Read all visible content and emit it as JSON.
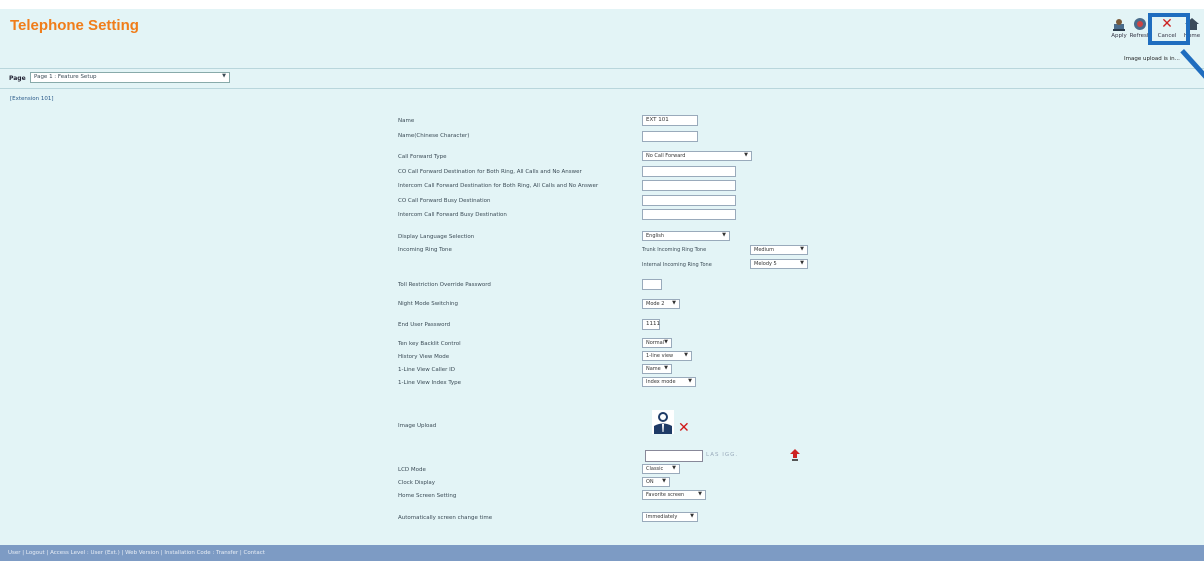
{
  "header": {
    "title": "Telephone Setting",
    "toolbar": {
      "apply_label": "Apply",
      "refresh_label": "Refresh",
      "cancel_label": "Cancel",
      "home_label": "Home"
    },
    "upload_message": "Image upload is in..."
  },
  "page": {
    "label": "Page",
    "selected": "Page 1 : Feature Setup"
  },
  "extension_label": "[Extension 101]",
  "form": {
    "name": {
      "label": "Name",
      "value": "EXT 101"
    },
    "name_chinese": {
      "label": "Name(Chinese Character)",
      "value": ""
    },
    "call_forward_type": {
      "label": "Call Forward Type",
      "value": "No Call Forward"
    },
    "co_cf_dest_all": {
      "label": "CO Call Forward Destination for Both Ring, All Calls and No Answer",
      "value": ""
    },
    "icm_cf_dest_all": {
      "label": "Intercom Call Forward Destination for Both Ring, All Calls and No Answer",
      "value": ""
    },
    "co_cf_busy": {
      "label": "CO Call Forward Busy Destination",
      "value": ""
    },
    "icm_cf_busy": {
      "label": "Intercom Call Forward Busy Destination",
      "value": ""
    },
    "display_language": {
      "label": "Display Language Selection",
      "value": "English"
    },
    "incoming_ring_tone": {
      "label": "Incoming Ring Tone",
      "trunk_label": "Trunk Incoming Ring Tone",
      "trunk_value": "Medium",
      "internal_label": "Internal Incoming Ring Tone",
      "internal_value": "Melody 5"
    },
    "toll_override": {
      "label": "Toll Restriction Override Password",
      "value": ""
    },
    "night_mode": {
      "label": "Night Mode Switching",
      "value": "Mode 2"
    },
    "end_user_password": {
      "label": "End User Password",
      "value": "1111"
    },
    "tenkey_backlit": {
      "label": "Ten key Backlit Control",
      "value": "Normal"
    },
    "history_view": {
      "label": "History View Mode",
      "value": "1-line view"
    },
    "line_caller_id": {
      "label": "1-Line View Caller ID",
      "value": "Name"
    },
    "line_index_type": {
      "label": "1-Line View Index Type",
      "value": "Index mode"
    },
    "image_upload": {
      "label": "Image Upload",
      "file_text": "LAS IGG."
    },
    "lcd_mode": {
      "label": "LCD Mode",
      "value": "Classic"
    },
    "clock_display": {
      "label": "Clock Display",
      "value": "ON"
    },
    "home_screen": {
      "label": "Home Screen Setting",
      "value": "Favorite screen"
    },
    "auto_screen_change": {
      "label": "Automatically screen change time",
      "value": "Immediately"
    }
  },
  "footer": {
    "text": "User | Logout | Access Level : User (Ext.) | Web Version | Installation Code : Transfer | Contact"
  },
  "colors": {
    "title": "#f07d1a",
    "background": "#e3f4f6",
    "footer": "#7d9bc4",
    "highlight": "#1f6dbf",
    "cancel": "#cc2222"
  },
  "icons": [
    "apply-icon",
    "refresh-icon",
    "cancel-icon",
    "home-icon",
    "avatar-icon",
    "delete-icon",
    "upload-icon"
  ]
}
